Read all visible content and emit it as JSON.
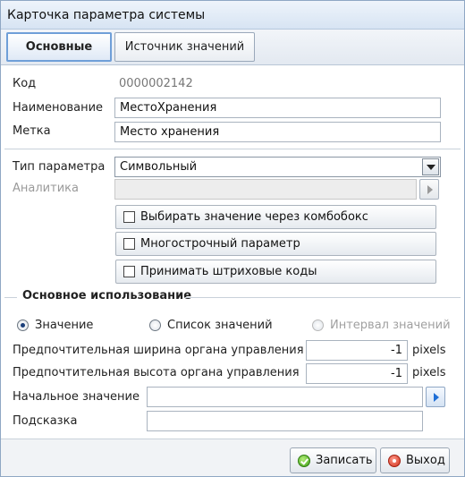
{
  "window": {
    "title": "Карточка параметра системы"
  },
  "tabs": [
    {
      "label": "Основные",
      "active": true
    },
    {
      "label": "Источник значений",
      "active": false
    }
  ],
  "fields": {
    "code": {
      "label": "Код",
      "value": "0000002142"
    },
    "name": {
      "label": "Наименование",
      "value": "МестоХранения"
    },
    "tag": {
      "label": "Метка",
      "value": "Место хранения"
    }
  },
  "param_type": {
    "label": "Тип параметра",
    "value": "Символьный"
  },
  "analytics": {
    "label": "Аналитика",
    "value": ""
  },
  "checkboxes": [
    {
      "label": "Выбирать значение через комбобокс",
      "checked": false
    },
    {
      "label": "Многострочный параметр",
      "checked": false
    },
    {
      "label": "Принимать штриховые коды",
      "checked": false
    }
  ],
  "main_usage": {
    "title": "Основное использование",
    "options": [
      {
        "label": "Значение",
        "checked": true,
        "enabled": true
      },
      {
        "label": "Список значений",
        "checked": false,
        "enabled": true
      },
      {
        "label": "Интервал значений",
        "checked": false,
        "enabled": false
      }
    ]
  },
  "preferred_width": {
    "label": "Предпочтительная ширина органа управления",
    "value": "-1",
    "unit": "pixels"
  },
  "preferred_height": {
    "label": "Предпочтительная высота органа управления",
    "value": "-1",
    "unit": "pixels"
  },
  "initial_value": {
    "label": "Начальное значение",
    "value": ""
  },
  "hint": {
    "label": "Подсказка",
    "value": ""
  },
  "buttons": {
    "save": "Записать",
    "exit": "Выход"
  },
  "colors": {
    "accent": "#6f9fd8",
    "save_icon": "#3c9d16",
    "exit_icon": "#d0301b"
  }
}
